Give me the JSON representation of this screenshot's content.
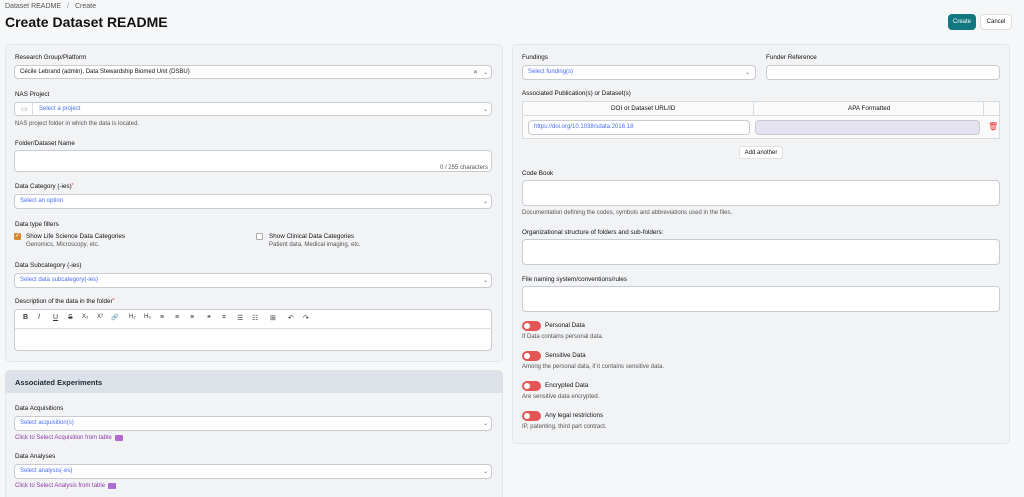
{
  "breadcrumb": {
    "parent": "Dataset README",
    "current": "Create"
  },
  "page": {
    "title": "Create Dataset README",
    "create_label": "Create",
    "cancel_label": "Cancel"
  },
  "left": {
    "research_group": {
      "label": "Research Group/Platform",
      "value": "Cécile Lebrand (admin), Data Stewardship Biomed Unit (DSBU)"
    },
    "nas": {
      "label": "NAS Project",
      "placeholder": "Select a project",
      "help": "NAS project folder in which the data is located."
    },
    "folder": {
      "label": "Folder/Dataset Name",
      "counter": "0 / 255 characters"
    },
    "category": {
      "label": "Data Category (-ies)",
      "placeholder": "Select an option"
    },
    "filters": {
      "label": "Data type filters",
      "life": {
        "label": "Show Life Science Data Categories",
        "sub": "Genomics, Microscopy, etc.",
        "checked": true
      },
      "clinical": {
        "label": "Show Clinical Data Categories",
        "sub": "Patient data, Medical imaging, etc.",
        "checked": false
      }
    },
    "subcategory": {
      "label": "Data Subcategory (-ies)",
      "placeholder": "Select data subcategory(-ies)"
    },
    "description": {
      "label": "Description of the data in the folder",
      "toolbar": [
        "B",
        "I",
        "U",
        "S",
        "X₂",
        "X²",
        "🔗",
        "H₂",
        "H₃",
        "≡",
        "≡",
        "≡",
        "❝",
        "⌗",
        "☰",
        "☷",
        "⊞",
        "↶",
        "↷"
      ]
    },
    "experiments": {
      "header": "Associated Experiments",
      "acq_label": "Data Acquisitions",
      "acq_placeholder": "Select acquisition(s)",
      "acq_link": "Click to Select Acquisition from table",
      "ana_label": "Data Analyses",
      "ana_placeholder": "Select analysis(-es)",
      "ana_link": "Click to Select Analysis from table"
    }
  },
  "right": {
    "fundings": {
      "label": "Fundings",
      "placeholder": "Select funding(s)"
    },
    "funder_ref": {
      "label": "Funder Reference"
    },
    "publications": {
      "label": "Associated Publication(s) or Dataset(s)",
      "col1": "DOI or Dataset URL/ID",
      "col2": "APA Formatted",
      "row_value": "https://doi.org/10.1038/sdata.2016.18",
      "add_label": "Add another"
    },
    "codebook": {
      "label": "Code Book",
      "help": "Documentation defining the codes, symbols and abbreviations used in the files."
    },
    "org": {
      "label": "Organizational structure of folders and sub-folders:"
    },
    "naming": {
      "label": "File naming system/conventions/rules"
    },
    "toggles": [
      {
        "label": "Personal Data",
        "help": "If Data contains personal data."
      },
      {
        "label": "Sensitive Data",
        "help": "Among the personal data, if it contains sensitive data."
      },
      {
        "label": "Encrypted Data",
        "help": "Are sensitive data encrypted."
      },
      {
        "label": "Any legal restrictions",
        "help": "IP, patenting, third part contract."
      }
    ]
  },
  "colors": {
    "accent": "#12777e",
    "toggle_on": "#e45555",
    "link": "#8e3aa8",
    "placeholder": "#4a6cf7"
  }
}
